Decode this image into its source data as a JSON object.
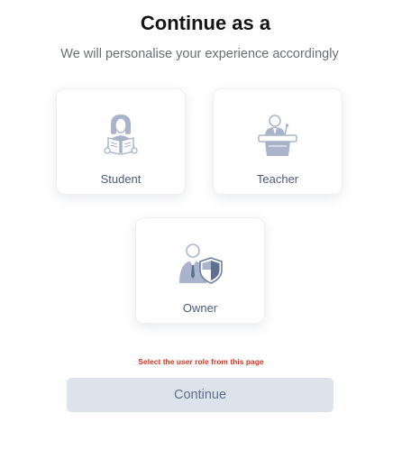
{
  "header": {
    "title": "Continue as a",
    "subtitle": "We will personalise your experience accordingly"
  },
  "roles": [
    {
      "label": "Student",
      "icon": "student-reading-icon"
    },
    {
      "label": "Teacher",
      "icon": "teacher-podium-icon"
    },
    {
      "label": "Owner",
      "icon": "owner-shield-icon"
    }
  ],
  "validation": {
    "message": "Select the user role from this page"
  },
  "actions": {
    "continue_label": "Continue"
  },
  "colors": {
    "icon_fill": "#a9b4cb",
    "label_text": "#4a5a7e",
    "error_text": "#d8321f",
    "button_bg": "#dde3eb",
    "button_text": "#5f6f8c"
  }
}
